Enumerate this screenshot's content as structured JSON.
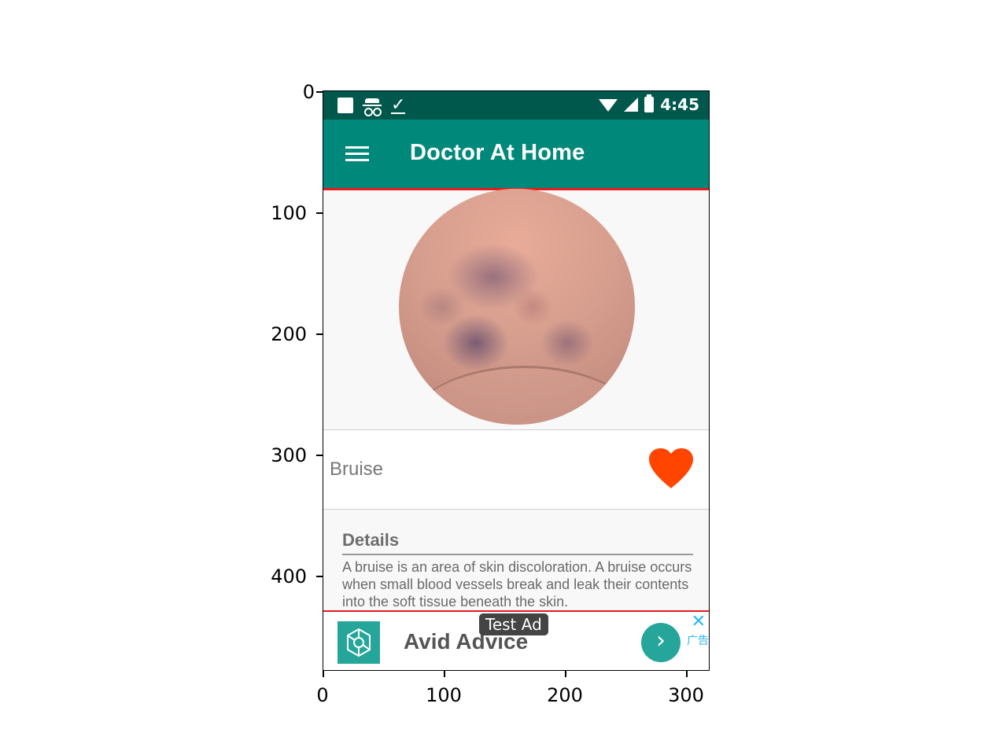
{
  "status_bar": {
    "time": "4:45",
    "left_icons": [
      "square-icon",
      "incognito-icon",
      "download-check-icon"
    ],
    "right_icons": [
      "wifi-icon",
      "signal-icon",
      "battery-icon"
    ]
  },
  "app_bar": {
    "title": "Doctor At Home",
    "menu_icon": "menu-icon"
  },
  "condition": {
    "name": "Bruise",
    "favorite_icon": "heart-icon",
    "favorite_color": "#ff4500"
  },
  "details": {
    "title": "Details",
    "text": "A bruise is an area of skin discoloration. A bruise occurs when small blood vessels break and leak their contents into the soft tissue beneath the skin."
  },
  "ad": {
    "label": "Test Ad",
    "title": "Avid Advice",
    "arrow": "›",
    "close": "✕",
    "badge": "广告"
  },
  "axes": {
    "y_ticks": [
      "0",
      "100",
      "200",
      "300",
      "400"
    ],
    "x_ticks": [
      "0",
      "100",
      "200",
      "300"
    ]
  },
  "colors": {
    "status_bar": "#00584c",
    "app_bar": "#00897b",
    "highlight": "#e41b1b",
    "ad_accent": "#26a69a"
  }
}
